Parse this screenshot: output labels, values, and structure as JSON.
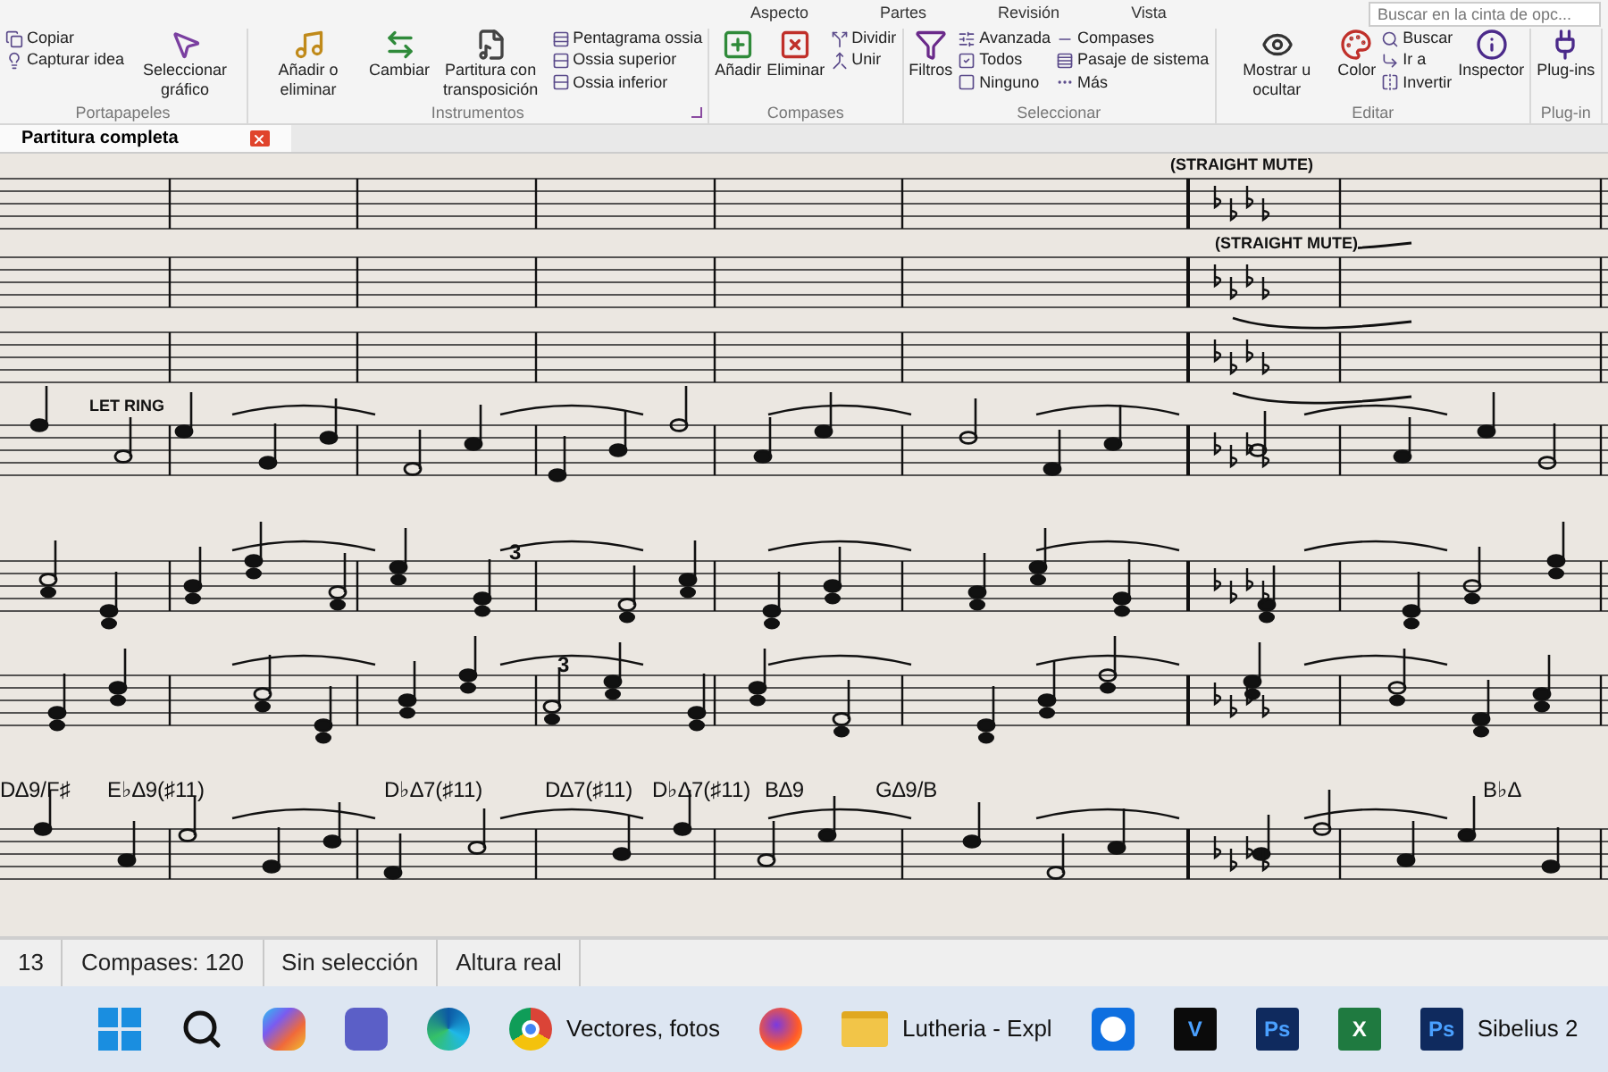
{
  "menu_tabs": [
    "Aspecto",
    "Partes",
    "Revisión",
    "Vista"
  ],
  "ribbon_search": {
    "placeholder": "Buscar en la cinta de opc..."
  },
  "ribbon": [
    {
      "label": "Portapapeles",
      "columns": [
        {
          "kind": "stack",
          "items": [
            "Copiar",
            "Capturar idea"
          ]
        },
        {
          "kind": "large",
          "label": "Seleccionar gráfico"
        }
      ]
    },
    {
      "label": "Instrumentos",
      "launcher": true,
      "columns": [
        {
          "kind": "large",
          "label": "Añadir o eliminar"
        },
        {
          "kind": "large",
          "label": "Cambiar"
        },
        {
          "kind": "large",
          "label": "Partitura con transposición"
        },
        {
          "kind": "stack",
          "items": [
            "Pentagrama ossia",
            "Ossia superior",
            "Ossia inferior"
          ]
        }
      ]
    },
    {
      "label": "Compases",
      "columns": [
        {
          "kind": "large",
          "label": "Añadir"
        },
        {
          "kind": "large",
          "label": "Eliminar"
        },
        {
          "kind": "stack",
          "items": [
            "Dividir",
            "Unir"
          ]
        }
      ]
    },
    {
      "label": "Seleccionar",
      "columns": [
        {
          "kind": "large",
          "label": "Filtros"
        },
        {
          "kind": "stack",
          "items": [
            "Avanzada",
            "Todos",
            "Ninguno"
          ]
        },
        {
          "kind": "stack",
          "items": [
            "Compases",
            "Pasaje de sistema",
            "Más"
          ]
        }
      ]
    },
    {
      "label": "Editar",
      "columns": [
        {
          "kind": "large",
          "label": "Mostrar u ocultar"
        },
        {
          "kind": "large",
          "label": "Color"
        },
        {
          "kind": "stack",
          "items": [
            "Buscar",
            "Ir a",
            "Invertir"
          ]
        },
        {
          "kind": "large",
          "label": "Inspector"
        }
      ]
    },
    {
      "label": "Plug-in",
      "columns": [
        {
          "kind": "large",
          "label": "Plug-ins"
        }
      ]
    }
  ],
  "document_tab": {
    "title": "Partitura completa",
    "selected": true
  },
  "score": {
    "directions": [
      "(STRAIGHT MUTE)",
      "(STRAIGHT MUTE)",
      "LET RING"
    ],
    "tuplets": [
      "3",
      "3"
    ],
    "chords": [
      "D∆9/F♯",
      "E♭∆9(♯11)",
      "D♭∆7(♯11)",
      "D∆7(♯11)",
      "D♭∆7(♯11)",
      "B∆9",
      "G∆9/B",
      "B♭∆"
    ]
  },
  "status_bar": [
    "13",
    "Compases: 120",
    "Sin selección",
    "Altura real"
  ],
  "taskbar": [
    {
      "kind": "windows"
    },
    {
      "kind": "search"
    },
    {
      "kind": "copilot"
    },
    {
      "kind": "teams"
    },
    {
      "kind": "edge"
    },
    {
      "kind": "chrome",
      "label": "Vectores, fotos"
    },
    {
      "kind": "firefox"
    },
    {
      "kind": "folder",
      "label": "Lutheria - Expl"
    },
    {
      "kind": "remote"
    },
    {
      "kind": "dark-tile",
      "glyph": "V"
    },
    {
      "kind": "photo-tile",
      "glyph": "Ps"
    },
    {
      "kind": "sheet",
      "glyph": "X"
    },
    {
      "kind": "photo-tile",
      "glyph": "Ps",
      "label": "Sibelius 2"
    }
  ]
}
